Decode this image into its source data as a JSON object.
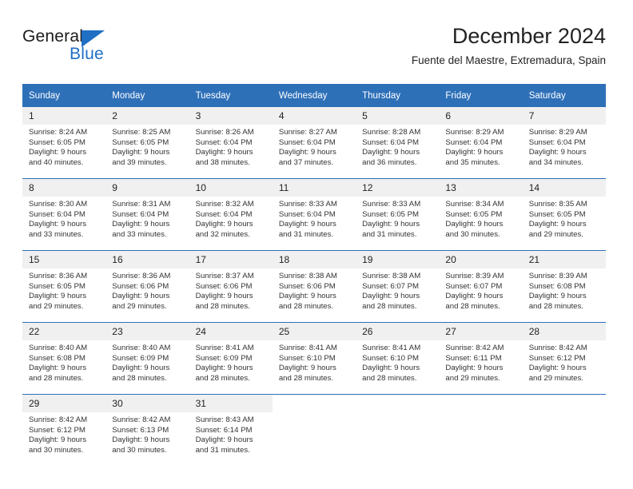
{
  "brand": {
    "word1": "General",
    "word2": "Blue",
    "flag_icon": "blue-triangle-flag-icon",
    "accent_color": "#1f6fc4"
  },
  "header": {
    "title": "December 2024",
    "subtitle": "Fuente del Maestre, Extremadura, Spain"
  },
  "theme": {
    "header_blue": "#2e70b8",
    "daynum_band": "#f0f0f0",
    "text": "#333333"
  },
  "calendar": {
    "weekday_headers": [
      "Sunday",
      "Monday",
      "Tuesday",
      "Wednesday",
      "Thursday",
      "Friday",
      "Saturday"
    ],
    "labels": {
      "sunrise": "Sunrise:",
      "sunset": "Sunset:",
      "daylight": "Daylight:"
    },
    "weeks": [
      [
        {
          "day": "1",
          "sunrise": "Sunrise: 8:24 AM",
          "sunset": "Sunset: 6:05 PM",
          "daylight1": "Daylight: 9 hours",
          "daylight2": "and 40 minutes."
        },
        {
          "day": "2",
          "sunrise": "Sunrise: 8:25 AM",
          "sunset": "Sunset: 6:05 PM",
          "daylight1": "Daylight: 9 hours",
          "daylight2": "and 39 minutes."
        },
        {
          "day": "3",
          "sunrise": "Sunrise: 8:26 AM",
          "sunset": "Sunset: 6:04 PM",
          "daylight1": "Daylight: 9 hours",
          "daylight2": "and 38 minutes."
        },
        {
          "day": "4",
          "sunrise": "Sunrise: 8:27 AM",
          "sunset": "Sunset: 6:04 PM",
          "daylight1": "Daylight: 9 hours",
          "daylight2": "and 37 minutes."
        },
        {
          "day": "5",
          "sunrise": "Sunrise: 8:28 AM",
          "sunset": "Sunset: 6:04 PM",
          "daylight1": "Daylight: 9 hours",
          "daylight2": "and 36 minutes."
        },
        {
          "day": "6",
          "sunrise": "Sunrise: 8:29 AM",
          "sunset": "Sunset: 6:04 PM",
          "daylight1": "Daylight: 9 hours",
          "daylight2": "and 35 minutes."
        },
        {
          "day": "7",
          "sunrise": "Sunrise: 8:29 AM",
          "sunset": "Sunset: 6:04 PM",
          "daylight1": "Daylight: 9 hours",
          "daylight2": "and 34 minutes."
        }
      ],
      [
        {
          "day": "8",
          "sunrise": "Sunrise: 8:30 AM",
          "sunset": "Sunset: 6:04 PM",
          "daylight1": "Daylight: 9 hours",
          "daylight2": "and 33 minutes."
        },
        {
          "day": "9",
          "sunrise": "Sunrise: 8:31 AM",
          "sunset": "Sunset: 6:04 PM",
          "daylight1": "Daylight: 9 hours",
          "daylight2": "and 33 minutes."
        },
        {
          "day": "10",
          "sunrise": "Sunrise: 8:32 AM",
          "sunset": "Sunset: 6:04 PM",
          "daylight1": "Daylight: 9 hours",
          "daylight2": "and 32 minutes."
        },
        {
          "day": "11",
          "sunrise": "Sunrise: 8:33 AM",
          "sunset": "Sunset: 6:04 PM",
          "daylight1": "Daylight: 9 hours",
          "daylight2": "and 31 minutes."
        },
        {
          "day": "12",
          "sunrise": "Sunrise: 8:33 AM",
          "sunset": "Sunset: 6:05 PM",
          "daylight1": "Daylight: 9 hours",
          "daylight2": "and 31 minutes."
        },
        {
          "day": "13",
          "sunrise": "Sunrise: 8:34 AM",
          "sunset": "Sunset: 6:05 PM",
          "daylight1": "Daylight: 9 hours",
          "daylight2": "and 30 minutes."
        },
        {
          "day": "14",
          "sunrise": "Sunrise: 8:35 AM",
          "sunset": "Sunset: 6:05 PM",
          "daylight1": "Daylight: 9 hours",
          "daylight2": "and 29 minutes."
        }
      ],
      [
        {
          "day": "15",
          "sunrise": "Sunrise: 8:36 AM",
          "sunset": "Sunset: 6:05 PM",
          "daylight1": "Daylight: 9 hours",
          "daylight2": "and 29 minutes."
        },
        {
          "day": "16",
          "sunrise": "Sunrise: 8:36 AM",
          "sunset": "Sunset: 6:06 PM",
          "daylight1": "Daylight: 9 hours",
          "daylight2": "and 29 minutes."
        },
        {
          "day": "17",
          "sunrise": "Sunrise: 8:37 AM",
          "sunset": "Sunset: 6:06 PM",
          "daylight1": "Daylight: 9 hours",
          "daylight2": "and 28 minutes."
        },
        {
          "day": "18",
          "sunrise": "Sunrise: 8:38 AM",
          "sunset": "Sunset: 6:06 PM",
          "daylight1": "Daylight: 9 hours",
          "daylight2": "and 28 minutes."
        },
        {
          "day": "19",
          "sunrise": "Sunrise: 8:38 AM",
          "sunset": "Sunset: 6:07 PM",
          "daylight1": "Daylight: 9 hours",
          "daylight2": "and 28 minutes."
        },
        {
          "day": "20",
          "sunrise": "Sunrise: 8:39 AM",
          "sunset": "Sunset: 6:07 PM",
          "daylight1": "Daylight: 9 hours",
          "daylight2": "and 28 minutes."
        },
        {
          "day": "21",
          "sunrise": "Sunrise: 8:39 AM",
          "sunset": "Sunset: 6:08 PM",
          "daylight1": "Daylight: 9 hours",
          "daylight2": "and 28 minutes."
        }
      ],
      [
        {
          "day": "22",
          "sunrise": "Sunrise: 8:40 AM",
          "sunset": "Sunset: 6:08 PM",
          "daylight1": "Daylight: 9 hours",
          "daylight2": "and 28 minutes."
        },
        {
          "day": "23",
          "sunrise": "Sunrise: 8:40 AM",
          "sunset": "Sunset: 6:09 PM",
          "daylight1": "Daylight: 9 hours",
          "daylight2": "and 28 minutes."
        },
        {
          "day": "24",
          "sunrise": "Sunrise: 8:41 AM",
          "sunset": "Sunset: 6:09 PM",
          "daylight1": "Daylight: 9 hours",
          "daylight2": "and 28 minutes."
        },
        {
          "day": "25",
          "sunrise": "Sunrise: 8:41 AM",
          "sunset": "Sunset: 6:10 PM",
          "daylight1": "Daylight: 9 hours",
          "daylight2": "and 28 minutes."
        },
        {
          "day": "26",
          "sunrise": "Sunrise: 8:41 AM",
          "sunset": "Sunset: 6:10 PM",
          "daylight1": "Daylight: 9 hours",
          "daylight2": "and 28 minutes."
        },
        {
          "day": "27",
          "sunrise": "Sunrise: 8:42 AM",
          "sunset": "Sunset: 6:11 PM",
          "daylight1": "Daylight: 9 hours",
          "daylight2": "and 29 minutes."
        },
        {
          "day": "28",
          "sunrise": "Sunrise: 8:42 AM",
          "sunset": "Sunset: 6:12 PM",
          "daylight1": "Daylight: 9 hours",
          "daylight2": "and 29 minutes."
        }
      ],
      [
        {
          "day": "29",
          "sunrise": "Sunrise: 8:42 AM",
          "sunset": "Sunset: 6:12 PM",
          "daylight1": "Daylight: 9 hours",
          "daylight2": "and 30 minutes."
        },
        {
          "day": "30",
          "sunrise": "Sunrise: 8:42 AM",
          "sunset": "Sunset: 6:13 PM",
          "daylight1": "Daylight: 9 hours",
          "daylight2": "and 30 minutes."
        },
        {
          "day": "31",
          "sunrise": "Sunrise: 8:43 AM",
          "sunset": "Sunset: 6:14 PM",
          "daylight1": "Daylight: 9 hours",
          "daylight2": "and 31 minutes."
        },
        {
          "day": "",
          "sunrise": "",
          "sunset": "",
          "daylight1": "",
          "daylight2": ""
        },
        {
          "day": "",
          "sunrise": "",
          "sunset": "",
          "daylight1": "",
          "daylight2": ""
        },
        {
          "day": "",
          "sunrise": "",
          "sunset": "",
          "daylight1": "",
          "daylight2": ""
        },
        {
          "day": "",
          "sunrise": "",
          "sunset": "",
          "daylight1": "",
          "daylight2": ""
        }
      ]
    ]
  }
}
